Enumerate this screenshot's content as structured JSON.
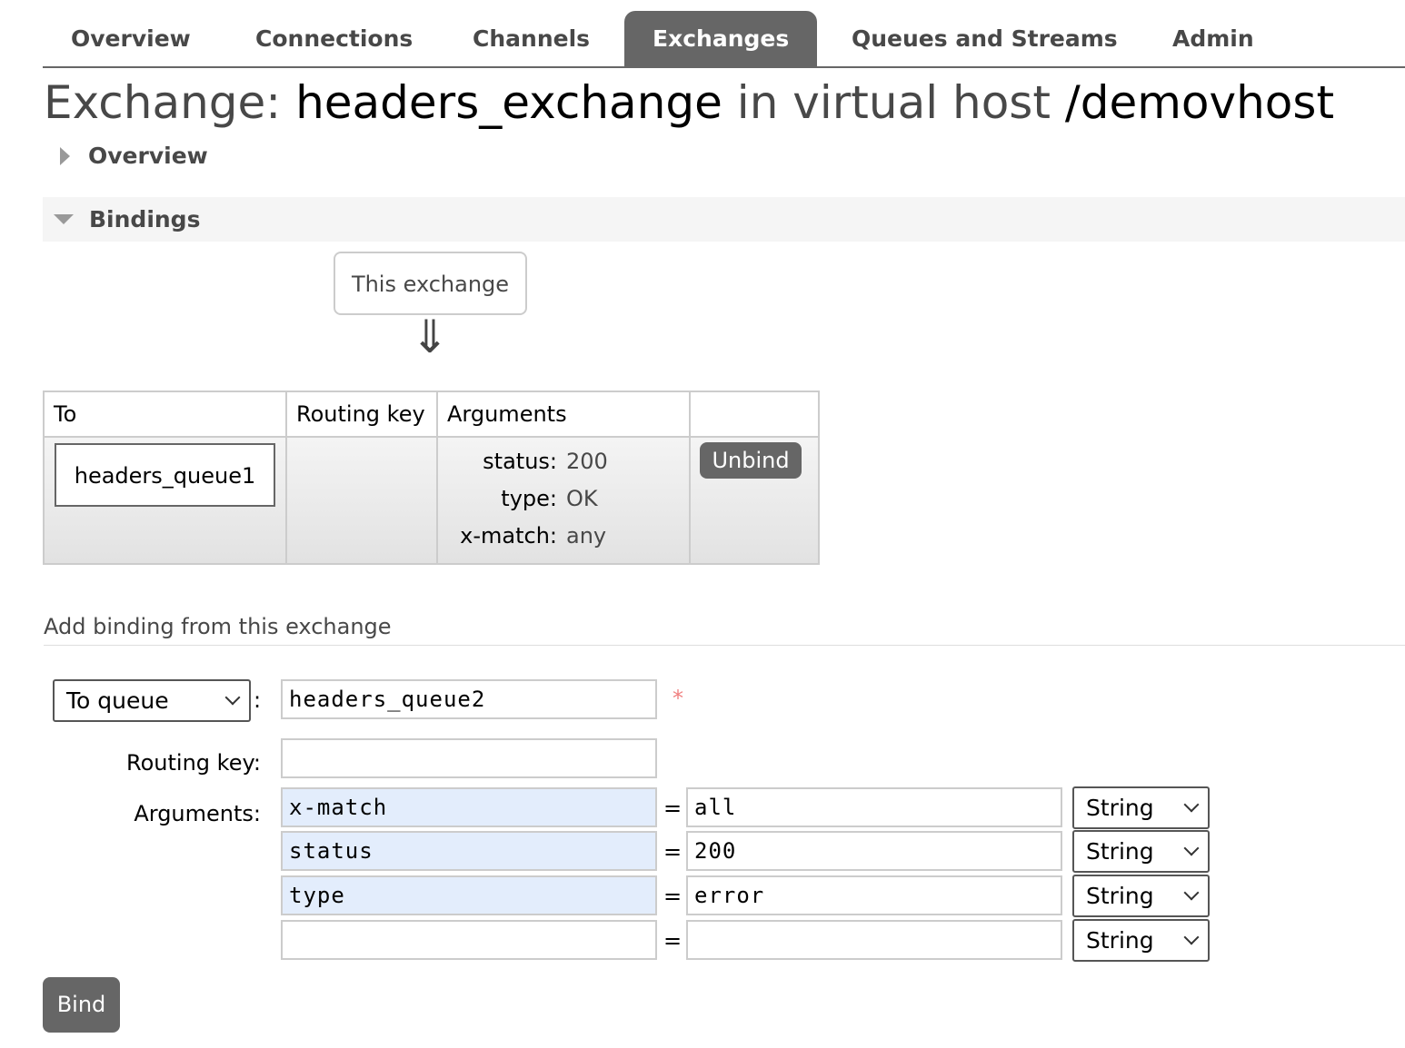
{
  "nav": {
    "tabs": [
      "Overview",
      "Connections",
      "Channels",
      "Exchanges",
      "Queues and Streams",
      "Admin"
    ],
    "active": "Exchanges"
  },
  "title": {
    "prefix": "Exchange:",
    "name": "headers_exchange",
    "middle": "in virtual host",
    "vhost": "/demovhost"
  },
  "sections": {
    "overview": "Overview",
    "bindings": "Bindings"
  },
  "bindings": {
    "source_label": "This exchange",
    "arrow": "⇓",
    "headers": [
      "To",
      "Routing key",
      "Arguments",
      ""
    ],
    "rows": [
      {
        "to": "headers_queue1",
        "routing_key": "",
        "arguments": [
          {
            "k": "status:",
            "v": "200"
          },
          {
            "k": "type:",
            "v": "OK"
          },
          {
            "k": "x-match:",
            "v": "any"
          }
        ],
        "action": "Unbind"
      }
    ]
  },
  "add_binding": {
    "title": "Add binding from this exchange",
    "dest_type": "To queue",
    "dest_value": "headers_queue2",
    "required_mark": "*",
    "routing_key_label": "Routing key:",
    "routing_key": "",
    "arguments_label": "Arguments:",
    "arguments": [
      {
        "k": "x-match",
        "v": "all",
        "t": "String"
      },
      {
        "k": "status",
        "v": "200",
        "t": "String"
      },
      {
        "k": "type",
        "v": "error",
        "t": "String"
      },
      {
        "k": "",
        "v": "",
        "t": "String"
      }
    ],
    "eq": "=",
    "colon": ":",
    "bind_label": "Bind"
  },
  "colors": {
    "accent": "#666666",
    "highlight": "#e3edfc",
    "required": "#f08080"
  }
}
